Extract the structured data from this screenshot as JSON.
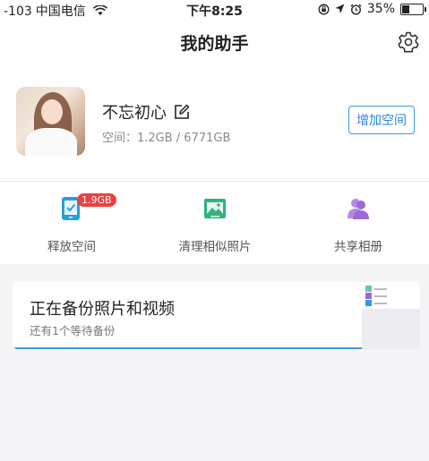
{
  "status_bar": {
    "signal": "-103",
    "carrier": "中国电信",
    "wifi_icon": "wifi-icon",
    "time": "下午8:25",
    "battery_percent": "35%",
    "battery_level": 0.35
  },
  "nav": {
    "title": "我的助手",
    "settings_icon": "gear-icon"
  },
  "profile": {
    "username": "不忘初心",
    "space_text": "空间：1.2GB / 6771GB",
    "add_space_label": "增加空间"
  },
  "actions": [
    {
      "label": "释放空间",
      "badge": "1.9GB",
      "icon": "phone-clean-icon",
      "color": "#2a9de0"
    },
    {
      "label": "清理相似照片",
      "icon": "photo-icon",
      "color": "#2fb47c"
    },
    {
      "label": "共享相册",
      "icon": "people-icon",
      "color": "#9b6ad6"
    }
  ],
  "backup": {
    "title": "正在备份照片和视频",
    "subtitle": "还有1个等待备份"
  },
  "colors": {
    "accent": "#3a97e8",
    "badge": "#ee3f3f"
  }
}
